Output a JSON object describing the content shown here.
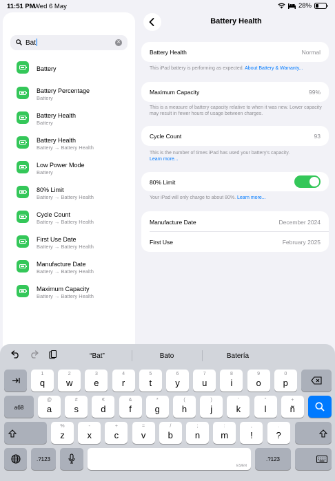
{
  "status": {
    "time": "11:51 PM",
    "date": "Wed 6 May",
    "battery_pct": "28%",
    "battery_level": 0.28
  },
  "search": {
    "value": "Bat"
  },
  "results": [
    {
      "title": "Battery",
      "subtitle": ""
    },
    {
      "title": "Battery Percentage",
      "subtitle": "Battery"
    },
    {
      "title": "Battery Health",
      "subtitle": "Battery"
    },
    {
      "title": "Battery Health",
      "subtitle": "Battery → Battery Health"
    },
    {
      "title": "Low Power Mode",
      "subtitle": "Battery"
    },
    {
      "title": "80% Limit",
      "subtitle": "Battery → Battery Health"
    },
    {
      "title": "Cycle Count",
      "subtitle": "Battery → Battery Health"
    },
    {
      "title": "First Use Date",
      "subtitle": "Battery → Battery Health"
    },
    {
      "title": "Manufacture Date",
      "subtitle": "Battery → Battery Health"
    },
    {
      "title": "Maximum Capacity",
      "subtitle": "Battery → Battery Health"
    }
  ],
  "detail": {
    "title": "Battery Health",
    "health_label": "Battery Health",
    "health_value": "Normal",
    "health_note": "This iPad battery is performing as expected.",
    "health_link": "About Battery & Warranty...",
    "capacity_label": "Maximum Capacity",
    "capacity_value": "99%",
    "capacity_note": "This is a measure of battery capacity relative to when it was new. Lower capacity may result in fewer hours of usage between charges.",
    "cycle_label": "Cycle Count",
    "cycle_value": "93",
    "cycle_note": "This is the number of times iPad has used your battery's capacity.",
    "cycle_link": "Learn more...",
    "limit_label": "80% Limit",
    "limit_on": true,
    "limit_note": "Your iPad will only charge to about 80%.",
    "limit_link": "Learn more...",
    "manufacture_label": "Manufacture Date",
    "manufacture_value": "December 2024",
    "first_use_label": "First Use",
    "first_use_value": "February 2025"
  },
  "keyboard": {
    "suggestions": [
      "“Bat”",
      "Bato",
      "Batería"
    ],
    "row1": [
      {
        "main": "q",
        "alt": "1"
      },
      {
        "main": "w",
        "alt": "2"
      },
      {
        "main": "e",
        "alt": "3"
      },
      {
        "main": "r",
        "alt": "4"
      },
      {
        "main": "t",
        "alt": "5"
      },
      {
        "main": "y",
        "alt": "6"
      },
      {
        "main": "u",
        "alt": "7"
      },
      {
        "main": "i",
        "alt": "8"
      },
      {
        "main": "o",
        "alt": "9"
      },
      {
        "main": "p",
        "alt": "0"
      }
    ],
    "row2": [
      {
        "main": "a",
        "alt": "@"
      },
      {
        "main": "s",
        "alt": "#"
      },
      {
        "main": "d",
        "alt": "€"
      },
      {
        "main": "f",
        "alt": "&"
      },
      {
        "main": "g",
        "alt": "*"
      },
      {
        "main": "h",
        "alt": "("
      },
      {
        "main": "j",
        "alt": ")"
      },
      {
        "main": "k",
        "alt": "'"
      },
      {
        "main": "l",
        "alt": "\""
      },
      {
        "main": "ñ",
        "alt": "+"
      }
    ],
    "row3": [
      {
        "main": "z",
        "alt": "%"
      },
      {
        "main": "x",
        "alt": "-"
      },
      {
        "main": "c",
        "alt": "+"
      },
      {
        "main": "v",
        "alt": "="
      },
      {
        "main": "b",
        "alt": "/"
      },
      {
        "main": "n",
        "alt": ";"
      },
      {
        "main": "m",
        "alt": ":"
      },
      {
        "main": "!",
        "alt": ","
      },
      {
        "main": "?",
        "alt": "."
      }
    ],
    "caps_label": "aб8",
    "numbers_label": ".?123",
    "space_lang": "ES/EN"
  }
}
